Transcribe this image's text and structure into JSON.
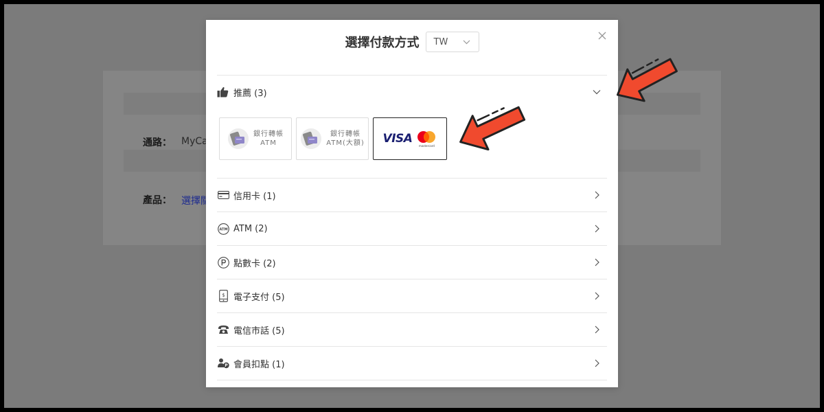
{
  "background": {
    "route_label": "通路：",
    "route_value": "MyCa",
    "product_label": "產品：",
    "product_link": "選擇關"
  },
  "modal": {
    "title": "選擇付款方式",
    "region": {
      "selected": "TW"
    },
    "recommended": {
      "label": "推薦 (3)",
      "icon": "thumbs-up-icon"
    },
    "tiles": [
      {
        "line1": "銀行轉帳",
        "line2": "ATM",
        "icon": "bank-transfer-icon"
      },
      {
        "line1": "銀行轉帳",
        "line2": "ATM(大額)",
        "icon": "bank-transfer-icon"
      },
      {
        "brand1": "VISA",
        "brand2": "mastercard",
        "selected": true
      }
    ],
    "categories": [
      {
        "label": "信用卡 (1)",
        "icon": "credit-card-icon"
      },
      {
        "label": "ATM (2)",
        "icon": "atm-icon"
      },
      {
        "label": "點數卡 (2)",
        "icon": "points-card-icon"
      },
      {
        "label": "電子支付 (5)",
        "icon": "mobile-payment-icon"
      },
      {
        "label": "電信市話 (5)",
        "icon": "telephone-icon"
      },
      {
        "label": "會員扣點 (1)",
        "icon": "member-points-icon"
      }
    ]
  },
  "colors": {
    "overlay": "#7b7b7b",
    "arrow": "#f04a2e",
    "visa_blue": "#1a1f71",
    "mc_red": "#eb001b",
    "mc_orange": "#f79e1b"
  }
}
